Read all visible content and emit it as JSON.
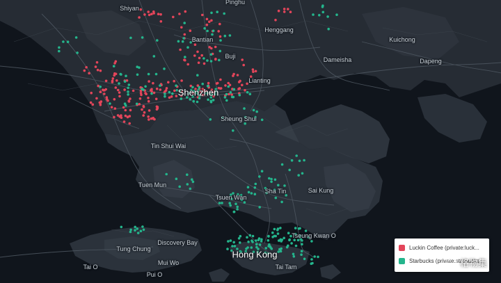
{
  "map": {
    "base_style": "dark",
    "colors": {
      "water": "#10151c",
      "land": "#2a3038",
      "land_light": "#3a424c",
      "road": "#4f5862",
      "luckin": "#e3455a",
      "starbucks": "#24b58c"
    },
    "labels": [
      {
        "text": "Shiyan",
        "type": "minor"
      },
      {
        "text": "Pinghu",
        "type": "minor"
      },
      {
        "text": "Henggang",
        "type": "minor"
      },
      {
        "text": "Kuichong",
        "type": "minor"
      },
      {
        "text": "Bantian",
        "type": "minor"
      },
      {
        "text": "Buji",
        "type": "minor"
      },
      {
        "text": "Dameisha",
        "type": "minor"
      },
      {
        "text": "Dapeng",
        "type": "minor"
      },
      {
        "text": "Lianting",
        "type": "minor"
      },
      {
        "text": "Shenzhen",
        "type": "major"
      },
      {
        "text": "Sheung Shui",
        "type": "minor"
      },
      {
        "text": "Tin Shui Wai",
        "type": "minor"
      },
      {
        "text": "Tuen Mun",
        "type": "minor"
      },
      {
        "text": "Sha Tin",
        "type": "minor"
      },
      {
        "text": "Sai Kung",
        "type": "minor"
      },
      {
        "text": "Tsuen Wan",
        "type": "minor"
      },
      {
        "text": "Tseung Kwan O",
        "type": "minor"
      },
      {
        "text": "Tung Chung",
        "type": "minor"
      },
      {
        "text": "Discovery Bay",
        "type": "minor"
      },
      {
        "text": "Hong Kong",
        "type": "major"
      },
      {
        "text": "Tai O",
        "type": "minor"
      },
      {
        "text": "Mui Wo",
        "type": "minor"
      },
      {
        "text": "Pui O",
        "type": "minor"
      },
      {
        "text": "Tai Tam",
        "type": "minor"
      }
    ]
  },
  "legend": {
    "items": [
      {
        "label": "Luckin Coffee (private:luck...",
        "color": "#e3455a"
      },
      {
        "label": "Starbucks (private:starbucks...",
        "color": "#24b58c"
      }
    ]
  },
  "watermark": {
    "text": "格物集"
  }
}
